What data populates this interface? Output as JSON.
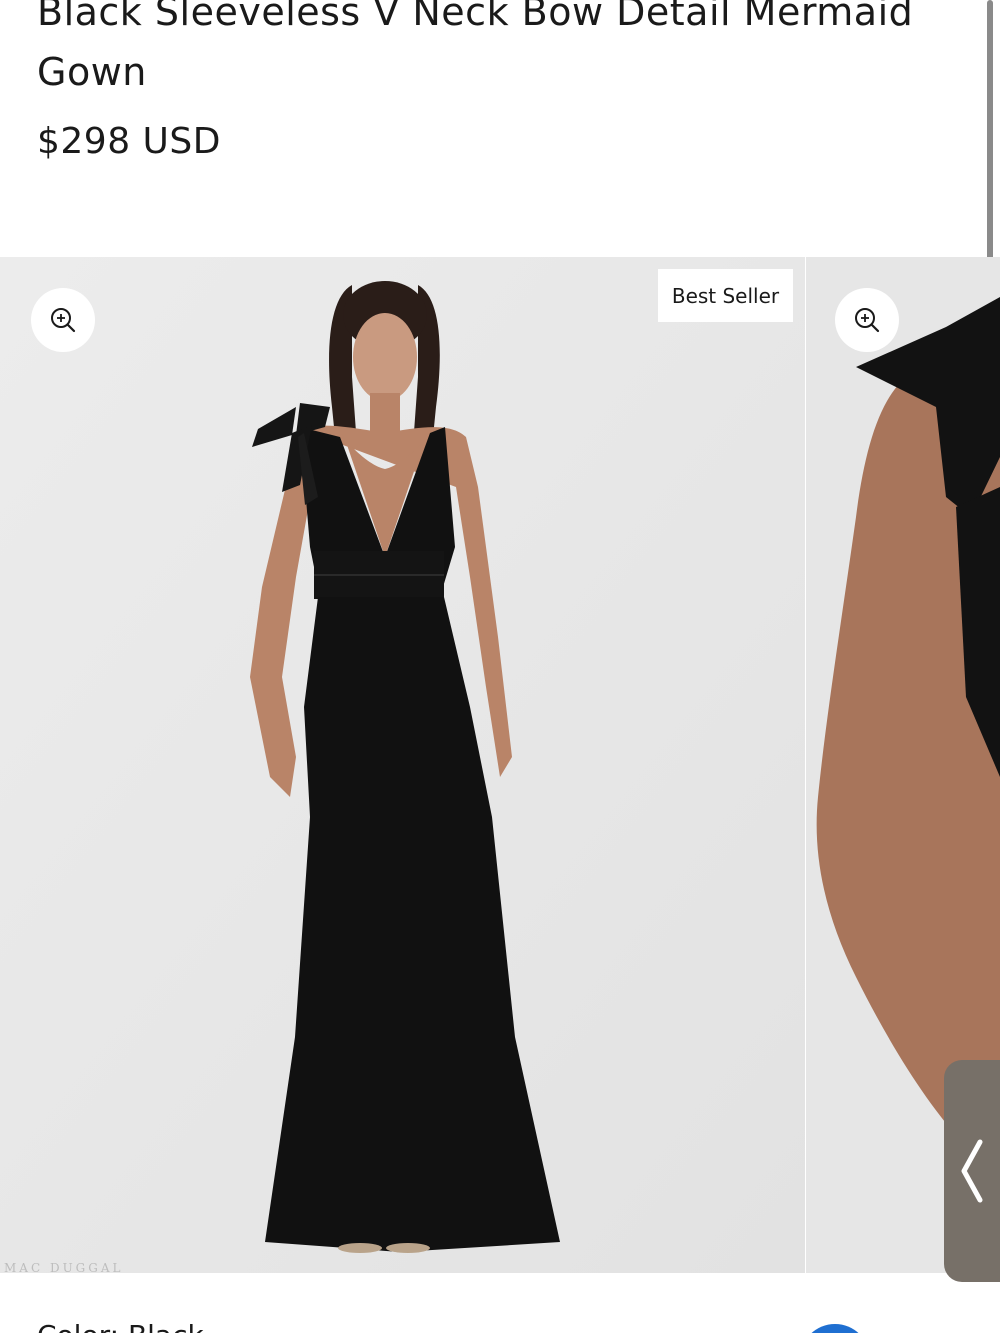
{
  "product": {
    "title": "Black Sleeveless V Neck Bow Detail Mermaid Gown",
    "price": "$298 USD"
  },
  "gallery": {
    "badge": "Best Seller",
    "watermark": "MAC DUGGAL",
    "icons": {
      "zoom": "zoom-in-icon",
      "prev": "chevron-left-icon"
    },
    "colors": {
      "background": "#eaeaea",
      "gown": "#111111",
      "skin": "#b98468",
      "nav_button": "#777068"
    }
  },
  "color_selector": {
    "label": "Color: Black",
    "swatch_color": "#1f6fd1"
  }
}
